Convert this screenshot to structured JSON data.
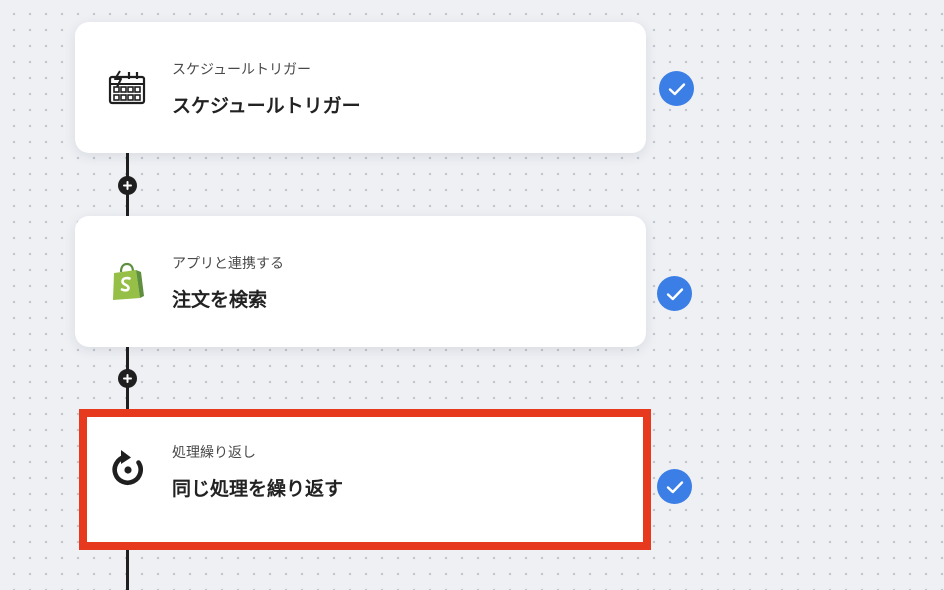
{
  "steps": [
    {
      "icon": "schedule-trigger-icon",
      "subtitle": "スケジュールトリガー",
      "title": "スケジュールトリガー",
      "status": "completed"
    },
    {
      "icon": "shopify-icon",
      "subtitle": "アプリと連携する",
      "title": "注文を検索",
      "status": "completed"
    },
    {
      "icon": "repeat-icon",
      "subtitle": "処理繰り返し",
      "title": "同じ処理を繰り返す",
      "status": "completed",
      "highlighted": true
    }
  ],
  "colors": {
    "canvas_background": "#eef0f4",
    "canvas_dots": "#c3c7cf",
    "connector": "#1f1f1f",
    "check_badge": "#3b7ee6",
    "highlight_border": "#e6391d",
    "shopify_green": "#95bf47",
    "shopify_dark_green": "#5e8e3e"
  }
}
